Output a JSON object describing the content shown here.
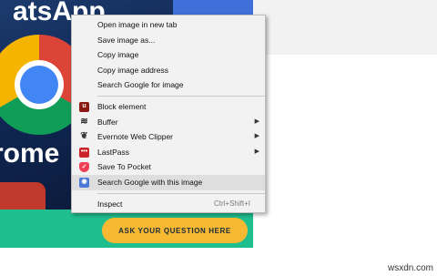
{
  "background": {
    "image_text_top": "atsApp",
    "image_text_bottom": "rome",
    "cta_label": "ASK YOUR QUESTION HERE",
    "watermark": "wsxdn.com"
  },
  "menu": {
    "group1": [
      {
        "label": "Open image in new tab"
      },
      {
        "label": "Save image as..."
      },
      {
        "label": "Copy image"
      },
      {
        "label": "Copy image address"
      },
      {
        "label": "Search Google for image"
      }
    ],
    "group2": [
      {
        "label": "Block element",
        "icon": "ublock-shield-icon"
      },
      {
        "label": "Buffer",
        "icon": "buffer-layers-icon",
        "submenu": true
      },
      {
        "label": "Evernote Web Clipper",
        "icon": "evernote-elephant-icon",
        "submenu": true
      },
      {
        "label": "LastPass",
        "icon": "lastpass-dots-icon",
        "submenu": true
      },
      {
        "label": "Save To Pocket",
        "icon": "pocket-icon"
      },
      {
        "label": "Search Google with this image",
        "icon": "google-camera-icon",
        "highlighted": true
      }
    ],
    "group3": [
      {
        "label": "Inspect",
        "shortcut": "Ctrl+Shift+I"
      }
    ]
  },
  "colors": {
    "cta": "#f7b832",
    "green_bar": "#1fbe8f",
    "menu_bg": "#f2f2f2",
    "highlight": "#dedede"
  }
}
